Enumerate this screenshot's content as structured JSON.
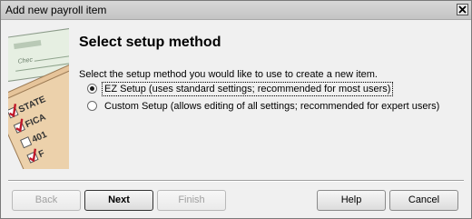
{
  "window": {
    "title": "Add new payroll item"
  },
  "heading": "Select setup method",
  "instruction": "Select the setup method you would like to use to create a new item.",
  "options": [
    {
      "label": "EZ Setup (uses standard settings; recommended for most users)",
      "selected": true
    },
    {
      "label": "Custom Setup (allows editing of all settings; recommended for expert users)",
      "selected": false
    }
  ],
  "buttons": {
    "back": "Back",
    "next": "Next",
    "finish": "Finish",
    "help": "Help",
    "cancel": "Cancel"
  },
  "illustration": {
    "checklist": [
      "STATE",
      "FICA",
      "401",
      "F"
    ],
    "check_word": "Chec"
  }
}
